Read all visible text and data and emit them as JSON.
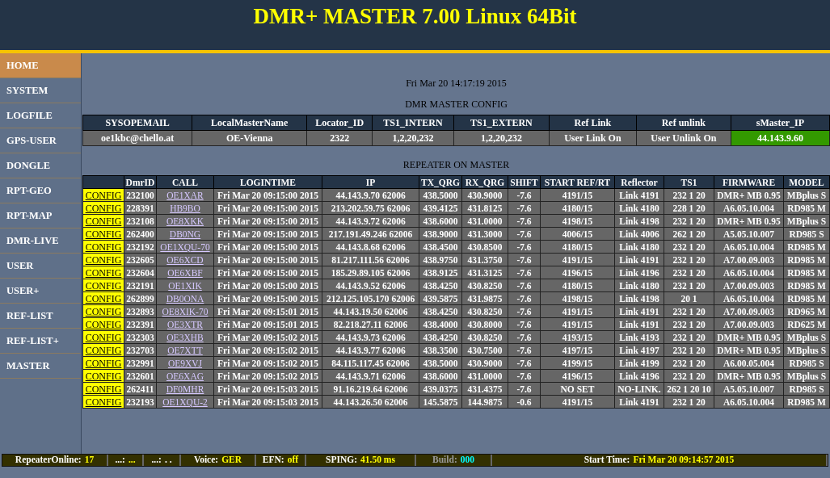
{
  "header": {
    "title": "DMR+ MASTER 7.00 Linux 64Bit"
  },
  "sidebar": {
    "items": [
      {
        "label": "HOME",
        "selected": true
      },
      {
        "label": "SYSTEM",
        "selected": false
      },
      {
        "label": "LOGFILE",
        "selected": false
      },
      {
        "label": "GPS-USER",
        "selected": false
      },
      {
        "label": "DONGLE",
        "selected": false
      },
      {
        "label": "RPT-GEO",
        "selected": false
      },
      {
        "label": "RPT-MAP",
        "selected": false
      },
      {
        "label": "DMR-LIVE",
        "selected": false
      },
      {
        "label": "USER",
        "selected": false
      },
      {
        "label": "USER+",
        "selected": false
      },
      {
        "label": "REF-LIST",
        "selected": false
      },
      {
        "label": "REF-LIST+",
        "selected": false
      },
      {
        "label": "MASTER",
        "selected": false
      }
    ]
  },
  "datetime": "Fri Mar 20 14:17:19 2015",
  "config_title": "DMR MASTER CONFIG",
  "config_table": {
    "columns": [
      "SYSOPEMAIL",
      "LocalMasterName",
      "Locator_ID",
      "TS1_INTERN",
      "TS1_EXTERN",
      "Ref Link",
      "Ref unlink",
      "sMaster_IP"
    ],
    "values": [
      {
        "text": "oe1kbc@chello.at",
        "highlighted": false
      },
      {
        "text": "OE-Vienna",
        "highlighted": false
      },
      {
        "text": "2322",
        "highlighted": false
      },
      {
        "text": "1,2,20,232",
        "highlighted": false
      },
      {
        "text": "1,2,20,232",
        "highlighted": false
      },
      {
        "text": "User Link On",
        "highlighted": false
      },
      {
        "text": "User Unlink On",
        "highlighted": false
      },
      {
        "text": "44.143.9.60",
        "highlighted": true
      }
    ]
  },
  "repeater_title": "REPEATER ON MASTER",
  "repeater_table": {
    "columns": [
      {
        "label": "DmrID",
        "kind": "text"
      },
      {
        "label": "CALL",
        "kind": "link"
      },
      {
        "label": "LOGINTIME",
        "kind": "text"
      },
      {
        "label": "IP",
        "kind": "text"
      },
      {
        "label": "TX_QRG",
        "kind": "text"
      },
      {
        "label": "RX_QRG",
        "kind": "text"
      },
      {
        "label": "SHIFT",
        "kind": "text"
      },
      {
        "label": "START REF/RT",
        "kind": "text"
      },
      {
        "label": "Reflector",
        "kind": "text"
      },
      {
        "label": "TS1",
        "kind": "text"
      },
      {
        "label": "FIRMWARE",
        "kind": "text"
      },
      {
        "label": "MODEL",
        "kind": "text"
      }
    ],
    "rows": [
      {
        "action": "CONFIG",
        "cells": [
          "232100",
          "OE1XAR",
          "Fri Mar 20 09:15:00 2015",
          "44.143.9.70 62006",
          "438.5000",
          "430.9000",
          "-7.6",
          "4191/15",
          "Link 4191",
          "232 1 20",
          "DMR+ MB 0.95",
          "MBplus S"
        ]
      },
      {
        "action": "CONFIG",
        "cells": [
          "228391",
          "HB9BO",
          "Fri Mar 20 09:15:00 2015",
          "213.202.59.75 62006",
          "439.4125",
          "431.8125",
          "-7.6",
          "4180/15",
          "Link 4180",
          "228 1 20",
          "A6.05.10.004",
          "RD985 M"
        ]
      },
      {
        "action": "CONFIG",
        "cells": [
          "232108",
          "OE8XKK",
          "Fri Mar 20 09:15:00 2015",
          "44.143.9.72 62006",
          "438.6000",
          "431.0000",
          "-7.6",
          "4198/15",
          "Link 4198",
          "232 1 20",
          "DMR+ MB 0.95",
          "MBplus S"
        ]
      },
      {
        "action": "CONFIG",
        "cells": [
          "262400",
          "DB0NG",
          "Fri Mar 20 09:15:00 2015",
          "217.191.49.246 62006",
          "438.9000",
          "431.3000",
          "-7.6",
          "4006/15",
          "Link 4006",
          "262 1 20",
          "A5.05.10.007",
          "RD985 S"
        ]
      },
      {
        "action": "CONFIG",
        "cells": [
          "232192",
          "OE1XQU-70",
          "Fri Mar 20 09:15:00 2015",
          "44.143.8.68 62006",
          "438.4500",
          "430.8500",
          "-7.6",
          "4180/15",
          "Link 4180",
          "232 1 20",
          "A6.05.10.004",
          "RD985 M"
        ]
      },
      {
        "action": "CONFIG",
        "cells": [
          "232605",
          "OE6XCD",
          "Fri Mar 20 09:15:00 2015",
          "81.217.111.56 62006",
          "438.9750",
          "431.3750",
          "-7.6",
          "4191/15",
          "Link 4191",
          "232 1 20",
          "A7.00.09.003",
          "RD985 M"
        ]
      },
      {
        "action": "CONFIG",
        "cells": [
          "232604",
          "OE6XBF",
          "Fri Mar 20 09:15:00 2015",
          "185.29.89.105 62006",
          "438.9125",
          "431.3125",
          "-7.6",
          "4196/15",
          "Link 4196",
          "232 1 20",
          "A6.05.10.004",
          "RD985 M"
        ]
      },
      {
        "action": "CONFIG",
        "cells": [
          "232191",
          "OE1XIK",
          "Fri Mar 20 09:15:00 2015",
          "44.143.9.52 62006",
          "438.4250",
          "430.8250",
          "-7.6",
          "4180/15",
          "Link 4180",
          "232 1 20",
          "A7.00.09.003",
          "RD985 M"
        ]
      },
      {
        "action": "CONFIG",
        "cells": [
          "262899",
          "DB0ONA",
          "Fri Mar 20 09:15:00 2015",
          "212.125.105.170 62006",
          "439.5875",
          "431.9875",
          "-7.6",
          "4198/15",
          "Link 4198",
          "20 1",
          "A6.05.10.004",
          "RD985 M"
        ]
      },
      {
        "action": "CONFIG",
        "cells": [
          "232893",
          "OE8XIK-70",
          "Fri Mar 20 09:15:01 2015",
          "44.143.19.50 62006",
          "438.4250",
          "430.8250",
          "-7.6",
          "4191/15",
          "Link 4191",
          "232 1 20",
          "A7.00.09.003",
          "RD965 M"
        ]
      },
      {
        "action": "CONFIG",
        "cells": [
          "232391",
          "OE3XTR",
          "Fri Mar 20 09:15:01 2015",
          "82.218.27.11 62006",
          "438.4000",
          "430.8000",
          "-7.6",
          "4191/15",
          "Link 4191",
          "232 1 20",
          "A7.00.09.003",
          "RD625 M"
        ]
      },
      {
        "action": "CONFIG",
        "cells": [
          "232303",
          "OE3XHB",
          "Fri Mar 20 09:15:02 2015",
          "44.143.9.73 62006",
          "438.4250",
          "430.8250",
          "-7.6",
          "4193/15",
          "Link 4193",
          "232 1 20",
          "DMR+ MB 0.95",
          "MBplus S"
        ]
      },
      {
        "action": "CONFIG",
        "cells": [
          "232703",
          "OE7XTT",
          "Fri Mar 20 09:15:02 2015",
          "44.143.9.77 62006",
          "438.3500",
          "430.7500",
          "-7.6",
          "4197/15",
          "Link 4197",
          "232 1 20",
          "DMR+ MB 0.95",
          "MBplus S"
        ]
      },
      {
        "action": "CONFIG",
        "cells": [
          "232991",
          "OE9XVJ",
          "Fri Mar 20 09:15:02 2015",
          "84.115.117.45 62006",
          "438.5000",
          "430.9000",
          "-7.6",
          "4199/15",
          "Link 4199",
          "232 1 20",
          "A6.00.05.004",
          "RD985 S"
        ]
      },
      {
        "action": "CONFIG",
        "cells": [
          "232601",
          "OE6XAG",
          "Fri Mar 20 09:15:02 2015",
          "44.143.9.71 62006",
          "438.6000",
          "431.0000",
          "-7.6",
          "4196/15",
          "Link 4196",
          "232 1 20",
          "DMR+ MB 0.95",
          "MBplus S"
        ]
      },
      {
        "action": "CONFIG",
        "cells": [
          "262411",
          "DF0MHR",
          "Fri Mar 20 09:15:03 2015",
          "91.16.219.64 62006",
          "439.0375",
          "431.4375",
          "-7.6",
          "NO SET",
          "NO-LINK.",
          "262 1 20 10",
          "A5.05.10.007",
          "RD985 S"
        ]
      },
      {
        "action": "CONFIG",
        "cells": [
          "232193",
          "OE1XQU-2",
          "Fri Mar 20 09:15:03 2015",
          "44.143.26.50 62006",
          "145.5875",
          "144.9875",
          "-0.6",
          "4191/15",
          "Link 4191",
          "232 1 20",
          "A6.05.10.004",
          "RD985 M"
        ]
      }
    ]
  },
  "status_bar": [
    {
      "label": "RepeaterOnline:",
      "value": "17",
      "kind": "highlight"
    },
    {
      "label": "...:",
      "value": "...",
      "kind": "highlight"
    },
    {
      "label": "...:",
      "value": ". .",
      "kind": "plain"
    },
    {
      "label": "Voice:",
      "value": "GER",
      "kind": "highlight"
    },
    {
      "label": "EFN:",
      "value": "off",
      "kind": "highlight"
    },
    {
      "label": "SPING:",
      "value": "41.50 ms",
      "kind": "highlight"
    },
    {
      "label": "Build:",
      "value": "000",
      "kind": "build"
    },
    {
      "label": "Start Time:",
      "value": "Fri Mar 20 09:14:57 2015",
      "kind": "highlight"
    }
  ]
}
